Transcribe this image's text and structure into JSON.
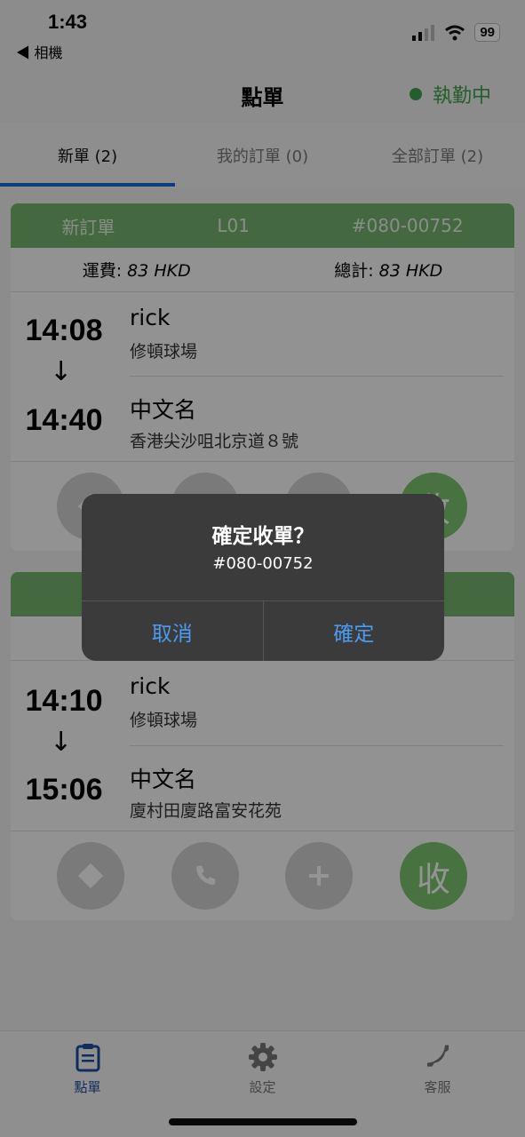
{
  "status_bar": {
    "time": "1:43",
    "back_app": "◀ 相機",
    "battery": "99"
  },
  "header": {
    "title": "點單",
    "duty_status": "執勤中",
    "duty_color": "#3fa34d"
  },
  "tabs": [
    {
      "label": "新單 (2)",
      "active": true
    },
    {
      "label": "我的訂單 (0)",
      "active": false
    },
    {
      "label": "全部訂單 (2)",
      "active": false
    }
  ],
  "orders": [
    {
      "type": "新訂單",
      "code": "L01",
      "number": "#080-00752",
      "fare_label": "運費:",
      "fare_value": "83 HKD",
      "total_label": "總計:",
      "total_value": "83 HKD",
      "pickup": {
        "time": "14:08",
        "name": "rick",
        "address": "修頓球場"
      },
      "dropoff": {
        "time": "14:40",
        "name": "中文名",
        "address": "香港尖沙咀北京道８號"
      },
      "accept_label": "收"
    },
    {
      "pickup": {
        "time": "14:10",
        "name": "rick",
        "address": "修頓球場"
      },
      "dropoff": {
        "time": "15:06",
        "name": "中文名",
        "address": "廈村田廈路富安花苑"
      },
      "accept_label": "收"
    }
  ],
  "dialog": {
    "title": "確定收單？",
    "message": "#080-00752",
    "cancel": "取消",
    "confirm": "確定"
  },
  "tab_bar": [
    {
      "label": "點單",
      "icon": "clipboard-icon",
      "active": true
    },
    {
      "label": "設定",
      "icon": "gear-icon",
      "active": false
    },
    {
      "label": "客服",
      "icon": "phone-icon",
      "active": false
    }
  ],
  "colors": {
    "accent": "#1a6bd9",
    "card_header": "#75b56e",
    "accept": "#7cc46f",
    "dialog_button": "#4c9bf0"
  }
}
